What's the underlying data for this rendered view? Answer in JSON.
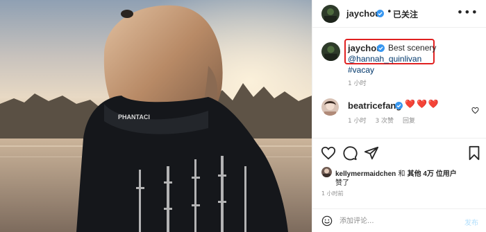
{
  "header": {
    "username": "jaychou",
    "separator": "•",
    "follow_status": "已关注",
    "more": "•••"
  },
  "caption": {
    "username": "jaychou",
    "text": "Best scenery",
    "mention": "@hannah_quinlivan",
    "hashtag": "#vacay",
    "time": "1 小时"
  },
  "comment": {
    "username": "beatricefang",
    "hearts": "❤️❤️❤️",
    "time": "1 小时",
    "likes": "3 次赞",
    "reply": "回复"
  },
  "photo": {
    "hoodie_text": "PHANTACI"
  },
  "likes": {
    "user": "kellymermaidchen",
    "and": " 和 ",
    "others": "其他 4万 位用户",
    "liked": "赞了"
  },
  "date": "1 小时前",
  "comment_box": {
    "placeholder": "添加评论...",
    "post_label": "发布"
  },
  "colors": {
    "verified": "#3897f0",
    "link": "#00376b",
    "highlight_box": "#e02020",
    "heart": "#ed4956"
  },
  "icons": [
    "more-options-icon",
    "verified-icon",
    "heart-icon",
    "comment-icon",
    "share-icon",
    "bookmark-icon",
    "emoji-icon"
  ]
}
